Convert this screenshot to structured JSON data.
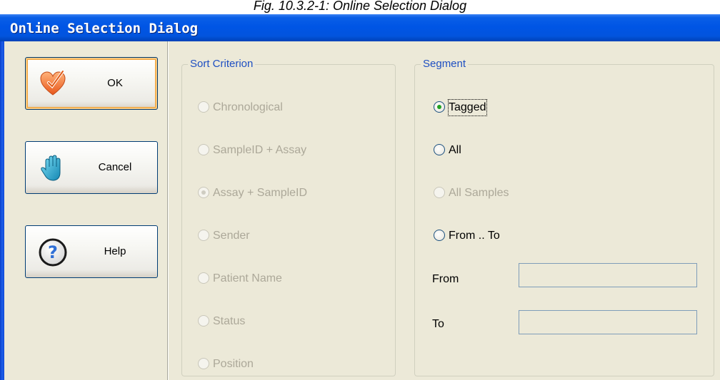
{
  "caption": "Fig. 10.3.2-1: Online Selection Dialog",
  "window": {
    "title": "Online Selection Dialog"
  },
  "buttons": {
    "ok": "OK",
    "cancel": "Cancel",
    "help": "Help"
  },
  "sort_criterion": {
    "legend": "Sort Criterion",
    "options": [
      {
        "label": "Chronological",
        "selected": false
      },
      {
        "label": "SampleID + Assay",
        "selected": false
      },
      {
        "label": "Assay + SampleID",
        "selected": true
      },
      {
        "label": "Sender",
        "selected": false
      },
      {
        "label": "Patient Name",
        "selected": false
      },
      {
        "label": "Status",
        "selected": false
      },
      {
        "label": "Position",
        "selected": false
      }
    ]
  },
  "segment": {
    "legend": "Segment",
    "options": [
      {
        "label": "Tagged",
        "selected": true,
        "enabled": true
      },
      {
        "label": "All",
        "selected": false,
        "enabled": true
      },
      {
        "label": "All Samples",
        "selected": false,
        "enabled": false
      },
      {
        "label": "From .. To",
        "selected": false,
        "enabled": true
      }
    ],
    "from_label": "From",
    "from_value": "",
    "to_label": "To",
    "to_value": ""
  },
  "colors": {
    "titlebar": "#0055e5",
    "dialog_bg": "#ece9d8",
    "groupbox_label": "#1e4fc2",
    "radio_selected": "#21a121",
    "disabled_text": "#aca899"
  },
  "icons": {
    "ok": "heart-check-icon",
    "cancel": "hand-stop-icon",
    "help": "question-mark-icon"
  }
}
